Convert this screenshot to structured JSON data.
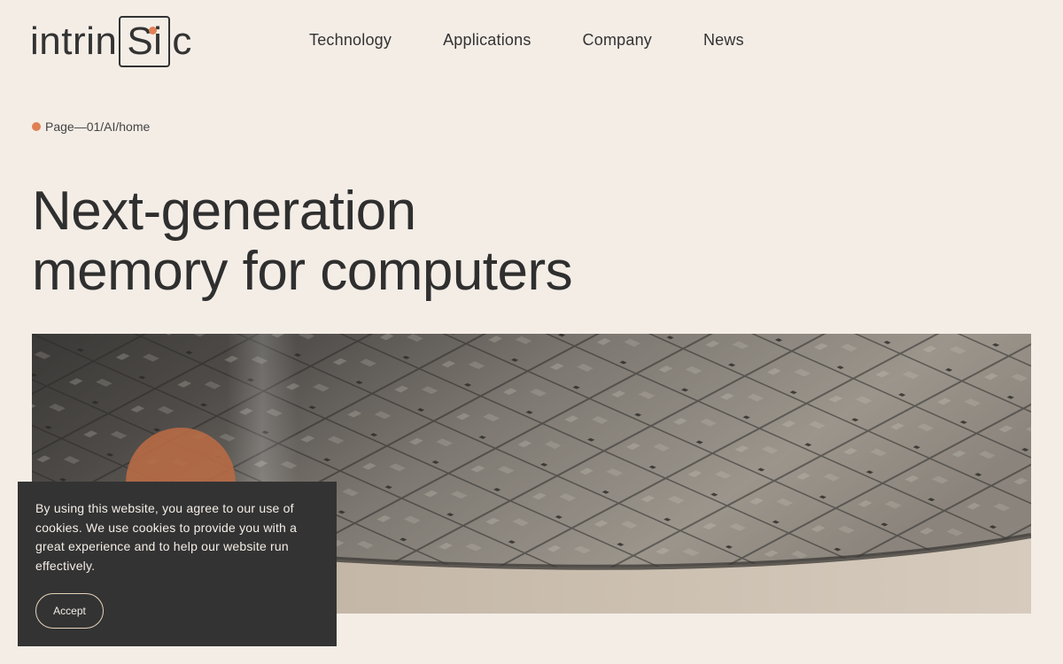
{
  "header": {
    "logo": {
      "prefix": "intrin",
      "boxed": "Si",
      "suffix": "c"
    },
    "nav": [
      "Technology",
      "Applications",
      "Company",
      "News"
    ]
  },
  "breadcrumb": "Page—01/AI/home",
  "hero": {
    "title_line1": "Next-generation",
    "title_line2": "memory for computers"
  },
  "cookie": {
    "text": "By using this website, you agree to our use of cookies. We use cookies to provide you with a great experience and to help our website run effectively.",
    "accept_label": "Accept"
  },
  "colors": {
    "background": "#f4ede6",
    "accent": "#e08055",
    "dark": "#333333"
  }
}
